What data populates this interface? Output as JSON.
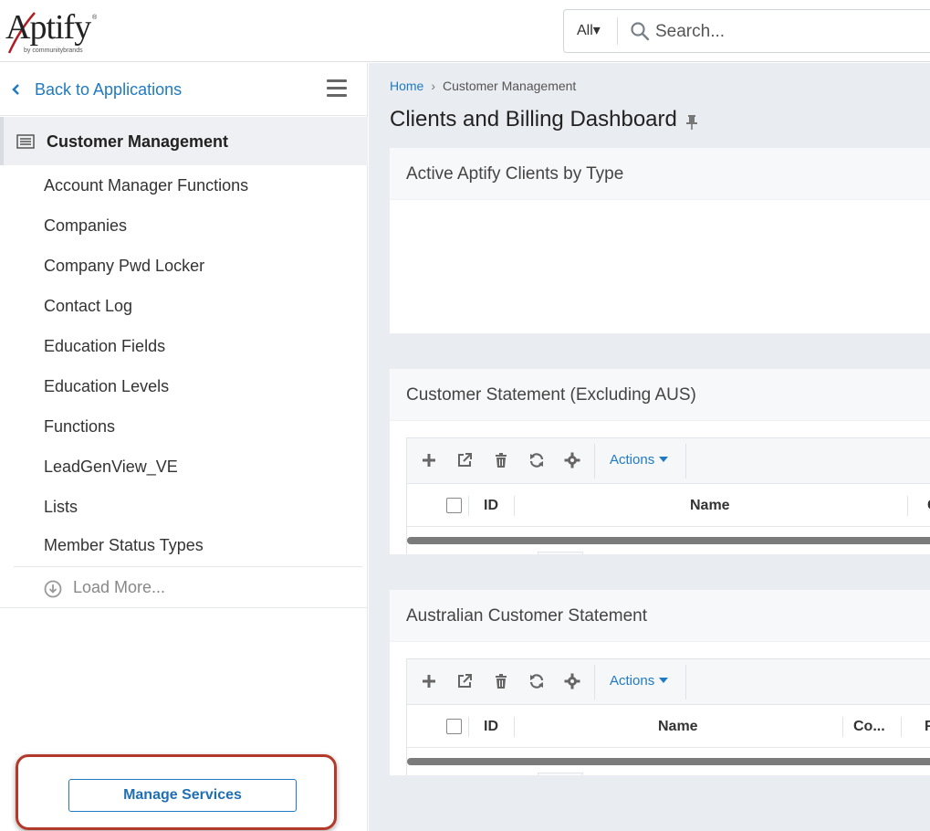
{
  "header": {
    "logo_text": "Aptify",
    "logo_byline": "by communitybrands",
    "logo_reg": "®",
    "search_scope": "All▾",
    "search_placeholder": "Search..."
  },
  "sidebar": {
    "back_label": "Back to Applications",
    "section_title": "Customer Management",
    "items": [
      {
        "label": "Account Manager Functions"
      },
      {
        "label": "Companies"
      },
      {
        "label": "Company Pwd Locker"
      },
      {
        "label": "Contact Log"
      },
      {
        "label": "Education Fields"
      },
      {
        "label": "Education Levels"
      },
      {
        "label": "Functions"
      },
      {
        "label": "LeadGenView_VE"
      },
      {
        "label": "Lists"
      },
      {
        "label": "Member Status Types"
      }
    ],
    "load_more_label": "Load More...",
    "manage_services_label": "Manage Services"
  },
  "main": {
    "breadcrumb": {
      "home": "Home",
      "separator": "›",
      "current": "Customer Management"
    },
    "page_title": "Clients and Billing Dashboard",
    "cards": [
      {
        "title": "Active Aptify Clients by Type"
      },
      {
        "title": "Customer Statement (Excluding AUS)",
        "actions_label": "Actions",
        "columns": [
          "ID",
          "Name",
          "C"
        ]
      },
      {
        "title": "Australian Customer Statement",
        "actions_label": "Actions",
        "columns": [
          "ID",
          "Name",
          "Co...",
          "F"
        ]
      }
    ]
  },
  "colors": {
    "link_blue": "#1f7ac1",
    "highlight_red": "#b33a2a",
    "main_bg": "#e9ecf0"
  },
  "icons": [
    "search-icon",
    "chevron-left-icon",
    "hamburger-icon",
    "list-icon",
    "pin-icon",
    "plus-icon",
    "external-link-icon",
    "trash-icon",
    "refresh-icon",
    "gear-icon",
    "download-circle-icon"
  ]
}
